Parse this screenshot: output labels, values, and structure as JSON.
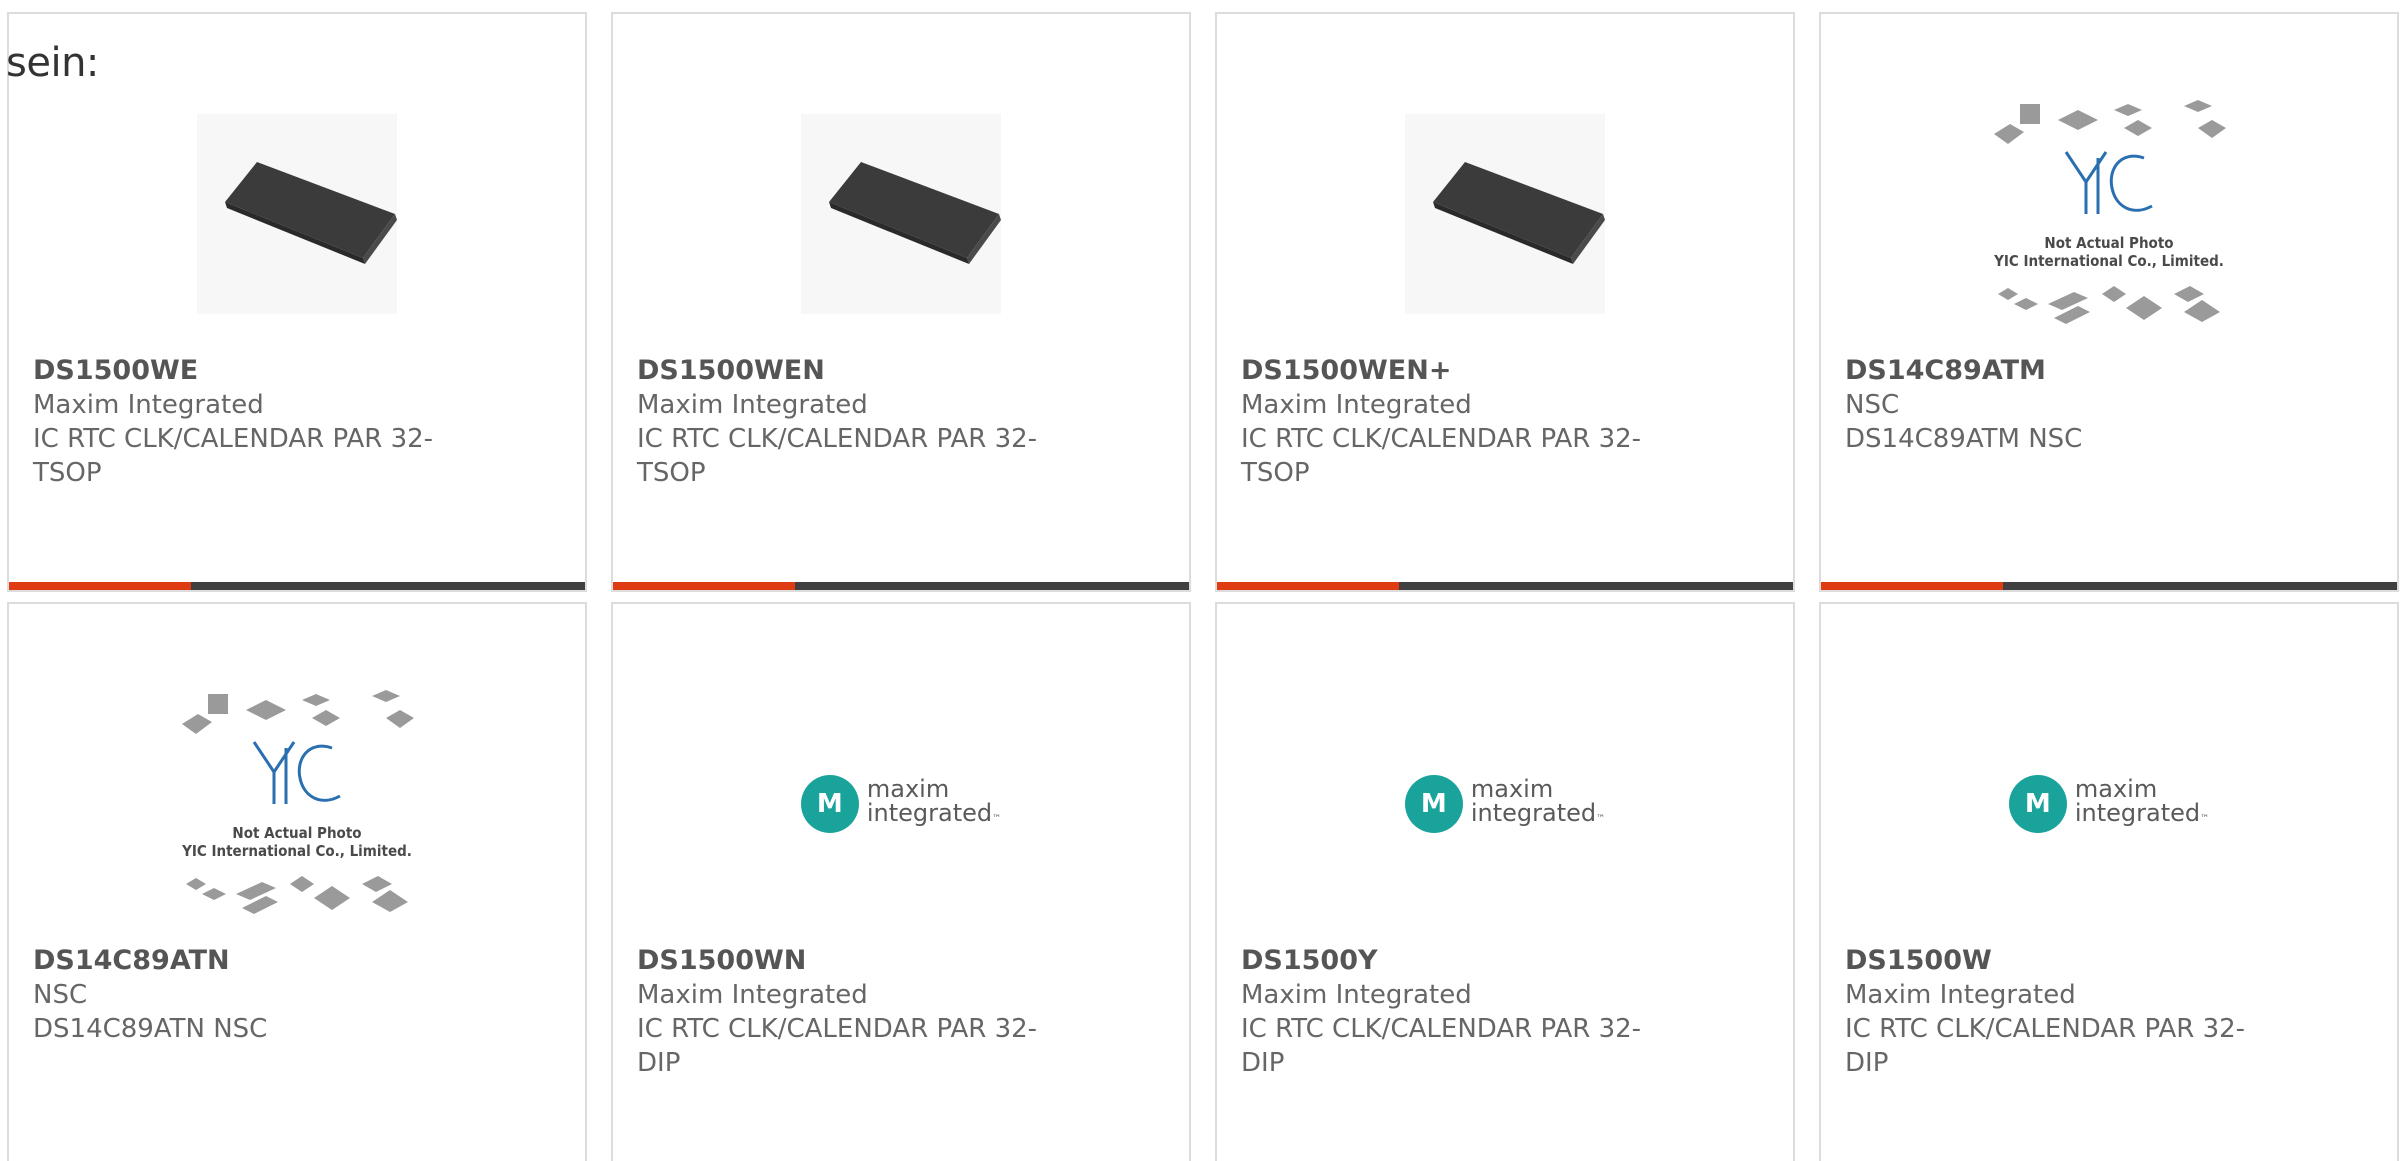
{
  "intro": "sein:",
  "colors": {
    "accent": "#e03c14",
    "bar": "#404040",
    "maxim_teal": "#1aa39a"
  },
  "yic": {
    "line1": "Not Actual Photo",
    "line2": "YIC International Co., Limited.",
    "logo": "YIC"
  },
  "maxim_logo": {
    "line1": "maxim",
    "line2": "integrated",
    "tm": "™"
  },
  "products": [
    {
      "part": "DS1500WE",
      "maker": "Maxim Integrated",
      "desc": "IC RTC CLK/CALENDAR PAR 32-TSOP",
      "image": "chip-photo"
    },
    {
      "part": "DS1500WEN",
      "maker": "Maxim Integrated",
      "desc": "IC RTC CLK/CALENDAR PAR 32-TSOP",
      "image": "chip-photo"
    },
    {
      "part": "DS1500WEN+",
      "maker": "Maxim Integrated",
      "desc": "IC RTC CLK/CALENDAR PAR 32-TSOP",
      "image": "chip-photo"
    },
    {
      "part": "DS14C89ATM",
      "maker": "NSC",
      "desc": "DS14C89ATM NSC",
      "image": "yic-placeholder"
    },
    {
      "part": "DS14C89ATN",
      "maker": "NSC",
      "desc": "DS14C89ATN NSC",
      "image": "yic-placeholder"
    },
    {
      "part": "DS1500WN",
      "maker": "Maxim Integrated",
      "desc": "IC RTC CLK/CALENDAR PAR 32-DIP",
      "image": "maxim-logo"
    },
    {
      "part": "DS1500Y",
      "maker": "Maxim Integrated",
      "desc": "IC RTC CLK/CALENDAR PAR 32-DIP",
      "image": "maxim-logo"
    },
    {
      "part": "DS1500W",
      "maker": "Maxim Integrated",
      "desc": "IC RTC CLK/CALENDAR PAR 32-DIP",
      "image": "maxim-logo"
    }
  ]
}
